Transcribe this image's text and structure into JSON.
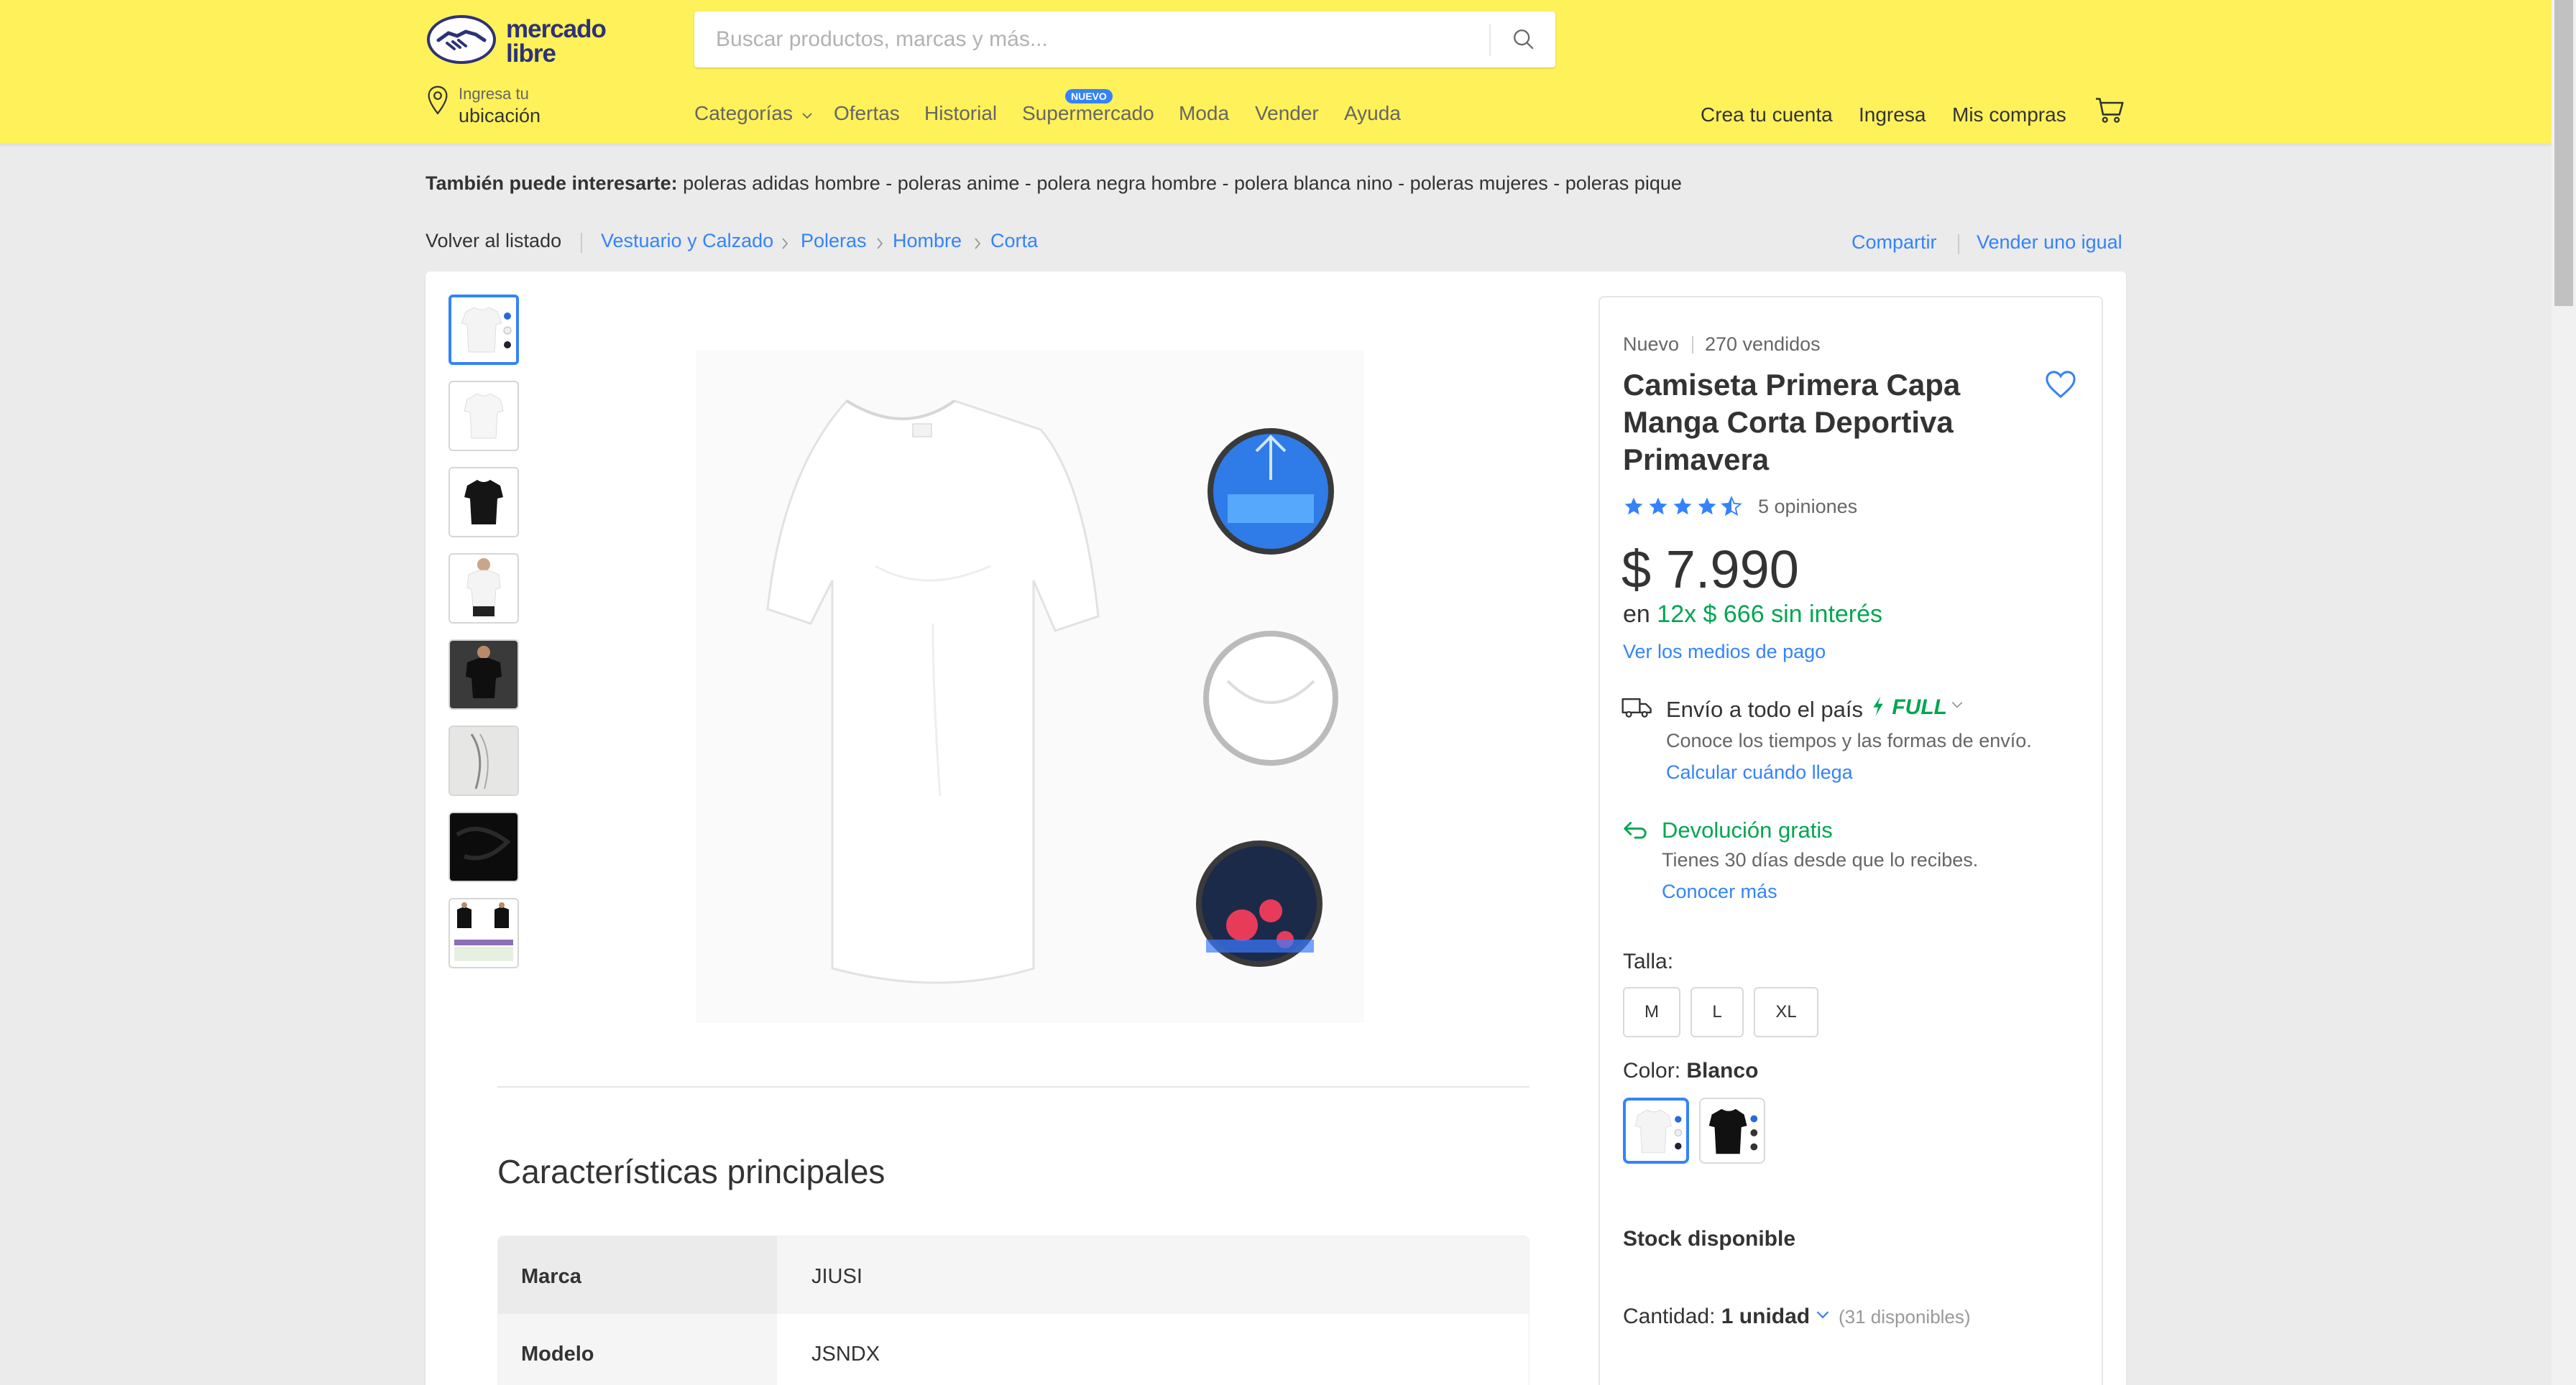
{
  "header": {
    "logo_line1": "mercado",
    "logo_line2": "libre",
    "search_placeholder": "Buscar productos, marcas y más...",
    "location_line1": "Ingresa tu",
    "location_line2": "ubicación",
    "nav": [
      "Categorías",
      "Ofertas",
      "Historial",
      "Supermercado",
      "Moda",
      "Vender",
      "Ayuda"
    ],
    "nuevo_badge": "NUEVO",
    "right_nav": [
      "Crea tu cuenta",
      "Ingresa",
      "Mis compras"
    ]
  },
  "related": {
    "label": "También puede interesarte:",
    "text": "poleras adidas hombre - poleras anime - polera negra hombre - polera blanca nino - poleras mujeres - poleras pique"
  },
  "breadcrumb": {
    "back": "Volver al listado",
    "items": [
      "Vestuario y Calzado",
      "Poleras",
      "Hombre",
      "Corta"
    ],
    "share": "Compartir",
    "sell_same": "Vender uno igual"
  },
  "product": {
    "condition": "Nuevo",
    "sold": "270 vendidos",
    "title": "Camiseta Primera Capa Manga Corta Deportiva Primavera",
    "rating": 4.5,
    "reviews": "5 opiniones",
    "price": "$ 7.990",
    "installments_prefix": "en",
    "installments": "12x $ 666 sin interés",
    "payment_link": "Ver los medios de pago",
    "shipping": "Envío a todo el país",
    "full_badge": "FULL",
    "shipping_sub": "Conoce los tiempos y las formas de envío.",
    "shipping_link": "Calcular cuándo llega",
    "return_title": "Devolución gratis",
    "return_sub": "Tienes 30 días desde que lo recibes.",
    "return_link": "Conocer más",
    "size_label": "Talla:",
    "sizes": [
      "M",
      "L",
      "XL"
    ],
    "color_label": "Color:",
    "color_value": "Blanco",
    "stock": "Stock disponible",
    "qty_label": "Cantidad:",
    "qty_value": "1 unidad",
    "qty_available": "(31 disponibles)"
  },
  "characteristics": {
    "title": "Características principales",
    "rows": [
      {
        "key": "Marca",
        "value": "JIUSI"
      },
      {
        "key": "Modelo",
        "value": "JSNDX"
      }
    ]
  },
  "colors": {
    "yellow": "#fff159",
    "blue": "#3483fa",
    "green": "#00a650",
    "navy": "#2d3277"
  }
}
